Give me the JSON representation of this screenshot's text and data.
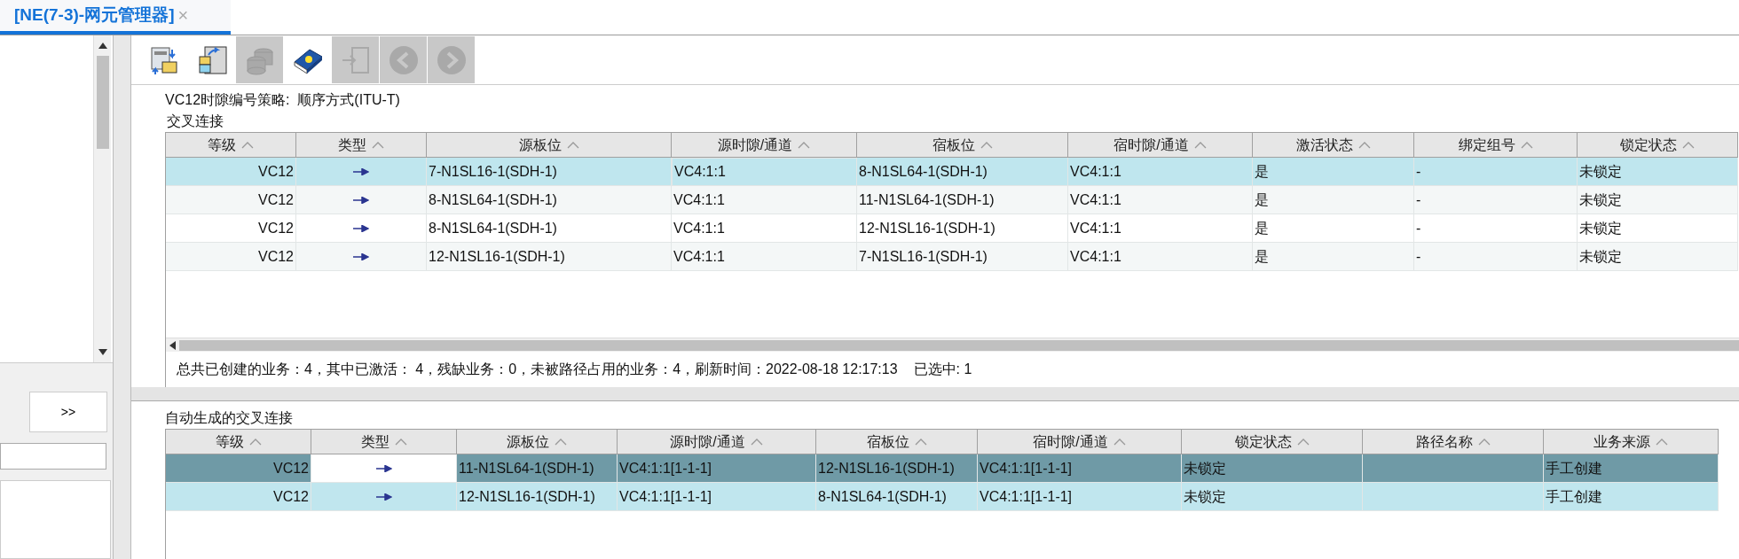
{
  "tab": {
    "title": "[NE(7-3)-网元管理器]",
    "close": "×",
    "selected": true
  },
  "side_panel": {
    "expand_button": ">>"
  },
  "toolbar": [
    {
      "kind": "sync",
      "disabled": false
    },
    {
      "kind": "board",
      "disabled": false
    },
    {
      "kind": "database",
      "disabled": true
    },
    {
      "kind": "help",
      "disabled": false
    },
    {
      "kind": "exit",
      "disabled": true
    },
    {
      "kind": "back",
      "disabled": true
    },
    {
      "kind": "forward",
      "disabled": true
    }
  ],
  "strategy": "VC12时隙编号策略:  顺序方式(ITU-T)",
  "cross_connections": {
    "title": "交叉连接",
    "columns": [
      "等级",
      "类型",
      "源板位",
      "源时隙/通道",
      "宿板位",
      "宿时隙/通道",
      "激活状态",
      "绑定组号",
      "锁定状态"
    ],
    "rows": [
      {
        "selected": true,
        "cells": [
          "VC12",
          {
            "kind": "arrow"
          },
          "7-N1SL16-1(SDH-1)",
          {
            "text": "VC4:1:1",
            "focused": true
          },
          "8-N1SL64-1(SDH-1)",
          "VC4:1:1",
          "是",
          "-",
          "未锁定"
        ]
      },
      {
        "selected": false,
        "cells": [
          "VC12",
          {
            "kind": "arrow"
          },
          "8-N1SL64-1(SDH-1)",
          "VC4:1:1",
          "11-N1SL64-1(SDH-1)",
          "VC4:1:1",
          "是",
          "-",
          "未锁定"
        ]
      },
      {
        "selected": false,
        "cells": [
          "VC12",
          {
            "kind": "arrow"
          },
          "8-N1SL64-1(SDH-1)",
          "VC4:1:1",
          "12-N1SL16-1(SDH-1)",
          "VC4:1:1",
          "是",
          "-",
          "未锁定"
        ]
      },
      {
        "selected": false,
        "cells": [
          "VC12",
          {
            "kind": "arrow"
          },
          "12-N1SL16-1(SDH-1)",
          "VC4:1:1",
          "7-N1SL16-1(SDH-1)",
          "VC4:1:1",
          "是",
          "-",
          "未锁定"
        ]
      }
    ]
  },
  "summary": "总共已创建的业务：4，其中已激活： 4，残缺业务：0，未被路径占用的业务：4，刷新时间：2022-08-18 12:17:13",
  "selected_count": "已选中: 1",
  "auto_connections": {
    "title": "自动生成的交叉连接",
    "columns": [
      "等级",
      "类型",
      "源板位",
      "源时隙/通道",
      "宿板位",
      "宿时隙/通道",
      "锁定状态",
      "路径名称",
      "业务来源"
    ],
    "rows": [
      {
        "selected": true,
        "cells": [
          "VC12",
          {
            "kind": "arrow"
          },
          "11-N1SL64-1(SDH-1)",
          "VC4:1:1[1-1-1]",
          "12-N1SL16-1(SDH-1)",
          "VC4:1:1[1-1-1]",
          "未锁定",
          "",
          "手工创建"
        ]
      },
      {
        "selected": false,
        "cells": [
          "VC12",
          {
            "kind": "arrow"
          },
          "12-N1SL16-1(SDH-1)",
          "VC4:1:1[1-1-1]",
          "8-N1SL64-1(SDH-1)",
          "VC4:1:1[1-1-1]",
          "未锁定",
          "",
          "手工创建"
        ]
      }
    ]
  }
}
